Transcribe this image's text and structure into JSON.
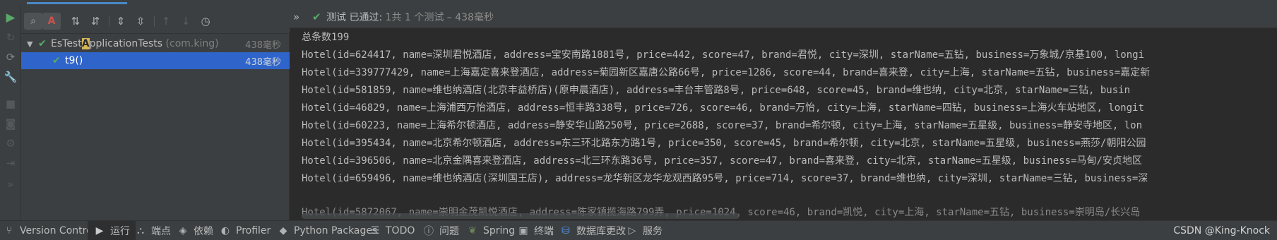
{
  "test_panel": {
    "collapse_label": "»",
    "status_prefix": "测试",
    "status_passed": "已通过:",
    "status_count": "1共 1 个测试 – 438毫秒"
  },
  "tree": {
    "root": {
      "name_pre": "EsTest",
      "name_hl": "A",
      "name_post": "pplicationTests",
      "package": "(com.king)",
      "time": "438毫秒"
    },
    "child": {
      "name": "t9()",
      "time": "438毫秒"
    }
  },
  "toolbar": {
    "search_filter_label": "A"
  },
  "console": {
    "lines": [
      "总条数199",
      "Hotel(id=624417, name=深圳君悦酒店, address=宝安南路1881号, price=442, score=47, brand=君悦, city=深圳, starName=五钻, business=万象城/京基100, longi",
      "Hotel(id=339777429, name=上海嘉定喜来登酒店, address=菊园新区嘉唐公路66号, price=1286, score=44, brand=喜来登, city=上海, starName=五钻, business=嘉定新",
      "Hotel(id=581859, name=维也纳酒店(北京丰益桥店)(原申晨酒店), address=丰台丰管路8号, price=648, score=45, brand=维也纳, city=北京, starName=三钻, busin",
      "Hotel(id=46829, name=上海浦西万怡酒店, address=恒丰路338号, price=726, score=46, brand=万怡, city=上海, starName=四钻, business=上海火车站地区, longit",
      "Hotel(id=60223, name=上海希尔顿酒店, address=静安华山路250号, price=2688, score=37, brand=希尔顿, city=上海, starName=五星级, business=静安寺地区, lon",
      "Hotel(id=395434, name=北京希尔顿酒店, address=东三环北路东方路1号, price=350, score=45, brand=希尔顿, city=北京, starName=五星级, business=燕莎/朝阳公园",
      "Hotel(id=396506, name=北京金隅喜来登酒店, address=北三环东路36号, price=357, score=47, brand=喜来登, city=北京, starName=五星级, business=马甸/安贞地区",
      "Hotel(id=659496, name=维也纳酒店(深圳国王店), address=龙华新区龙华龙观西路95号, price=714, score=37, brand=维也纳, city=深圳, starName=三钻, business=深",
      "Hotel(id=5872067, name=崇明金茂凯悦酒店, address=陈家镇揽海路799弄, price=1024, score=46, brand=凯悦, city=上海, starName=五钻, business=崇明岛/长兴岛"
    ]
  },
  "bottom_bar": {
    "items": [
      {
        "label": "Version Control",
        "icon": "branch-icon"
      },
      {
        "label": "运行",
        "icon": "run-icon"
      },
      {
        "label": "端点",
        "icon": "endpoints-icon"
      },
      {
        "label": "依赖",
        "icon": "dependencies-icon"
      },
      {
        "label": "Profiler",
        "icon": "profiler-icon"
      },
      {
        "label": "Python Packages",
        "icon": "python-packages-icon"
      },
      {
        "label": "TODO",
        "icon": "todo-icon"
      },
      {
        "label": "问题",
        "icon": "problems-icon"
      },
      {
        "label": "Spring",
        "icon": "spring-icon"
      },
      {
        "label": "终端",
        "icon": "terminal-icon"
      },
      {
        "label": "数据库更改",
        "icon": "database-changes-icon"
      },
      {
        "label": "服务",
        "icon": "services-icon"
      }
    ],
    "watermark": "CSDN @King-Knock"
  },
  "colors": {
    "pass_green": "#59a869",
    "selection_blue": "#2f65ca",
    "panel_bg": "#3c3f41",
    "console_bg": "#2b2b2b"
  }
}
